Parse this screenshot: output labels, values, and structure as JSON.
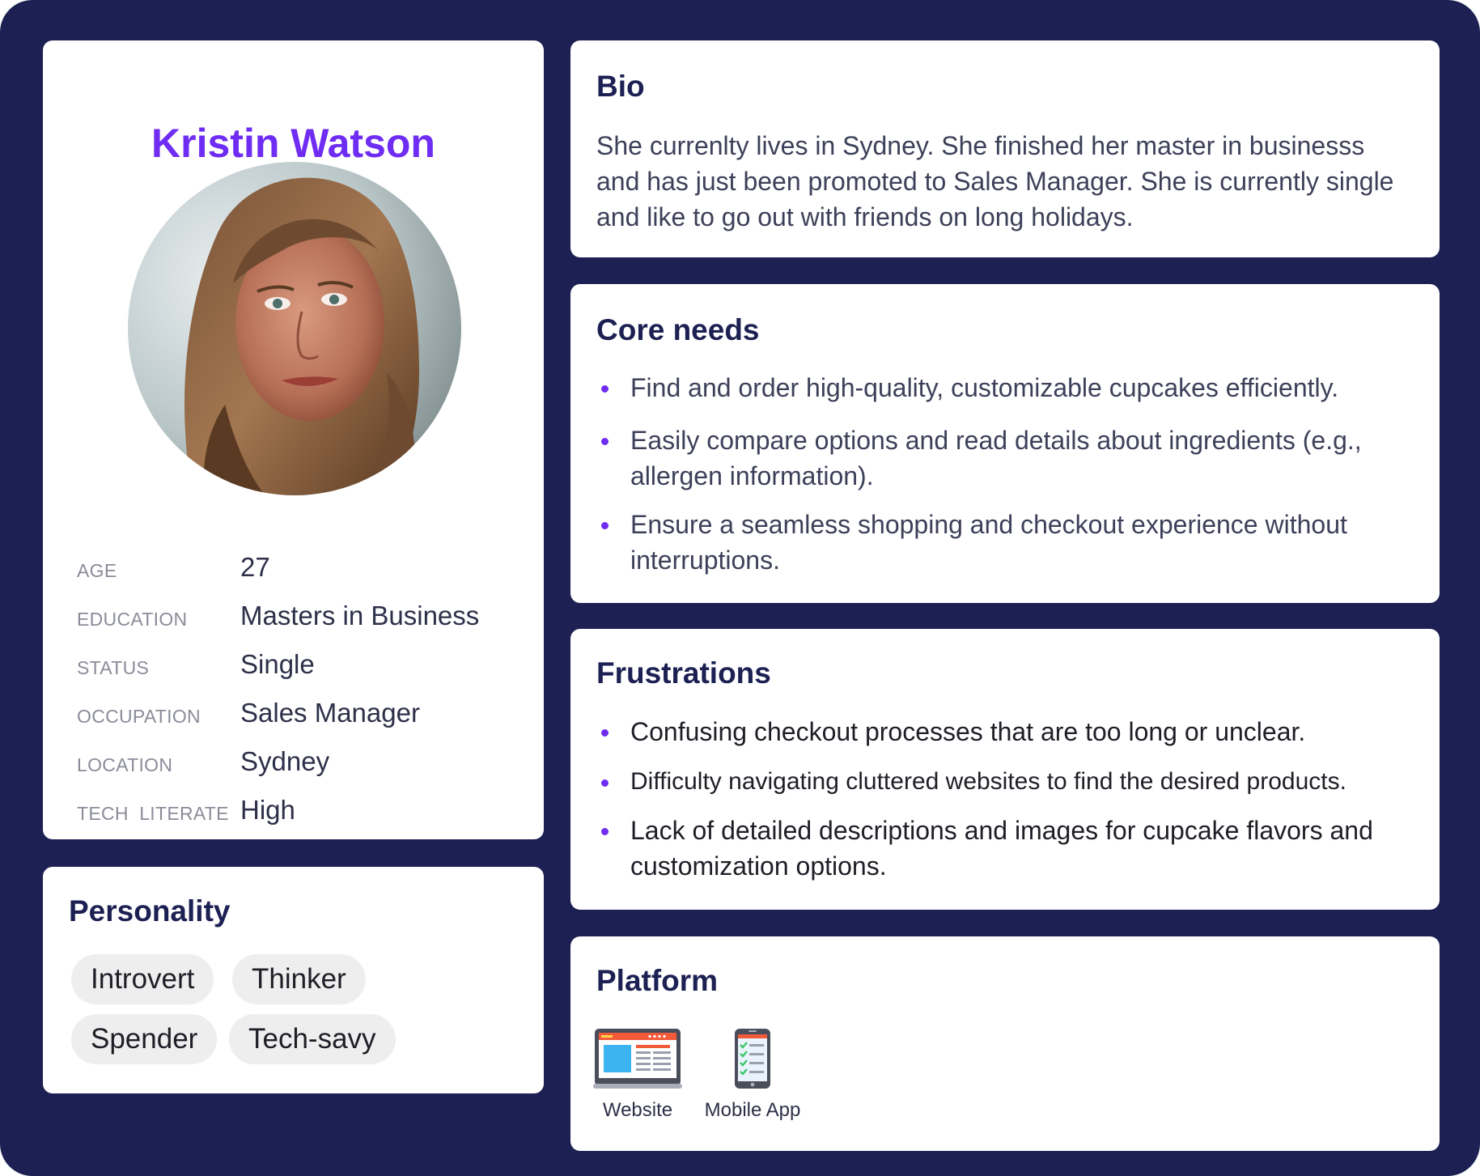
{
  "profile": {
    "name": "Kristin Watson",
    "attributes": [
      {
        "label": "AGE",
        "value": "27"
      },
      {
        "label": "EDUCATION",
        "value": "Masters in Business"
      },
      {
        "label": "STATUS",
        "value": "Single"
      },
      {
        "label": "OCCUPATION",
        "value": "Sales Manager"
      },
      {
        "label": "LOCATION",
        "value": "Sydney"
      },
      {
        "label": "TECH  LITERATE",
        "value": "High"
      }
    ]
  },
  "personality": {
    "title": "Personality",
    "traits": [
      "Introvert",
      "Thinker",
      "Spender",
      "Tech-savy"
    ]
  },
  "bio": {
    "title": "Bio",
    "text": "She currenlty lives in Sydney. She finished her master in businesss and has just been promoted to Sales Manager. She is currently single and like to go out with friends on long holidays."
  },
  "core_needs": {
    "title": "Core needs",
    "items": [
      "Find and order high-quality, customizable cupcakes efficiently.",
      "Easily compare options and read details about ingredients (e.g., allergen information).",
      "Ensure a seamless shopping and checkout experience without interruptions."
    ]
  },
  "frustrations": {
    "title": "Frustrations",
    "items": [
      "Confusing checkout processes that are too long or unclear.",
      "Difficulty navigating cluttered websites to find the desired products.",
      "Lack of detailed descriptions and images for cupcake flavors and customization options."
    ]
  },
  "platform": {
    "title": "Platform",
    "items": [
      {
        "label": "Website",
        "icon": "website-icon"
      },
      {
        "label": "Mobile App",
        "icon": "mobile-app-icon"
      }
    ]
  },
  "colors": {
    "background": "#1c2052",
    "accent": "#6f2cf2",
    "heading": "#1c2052",
    "chip": "#eeeeee"
  }
}
